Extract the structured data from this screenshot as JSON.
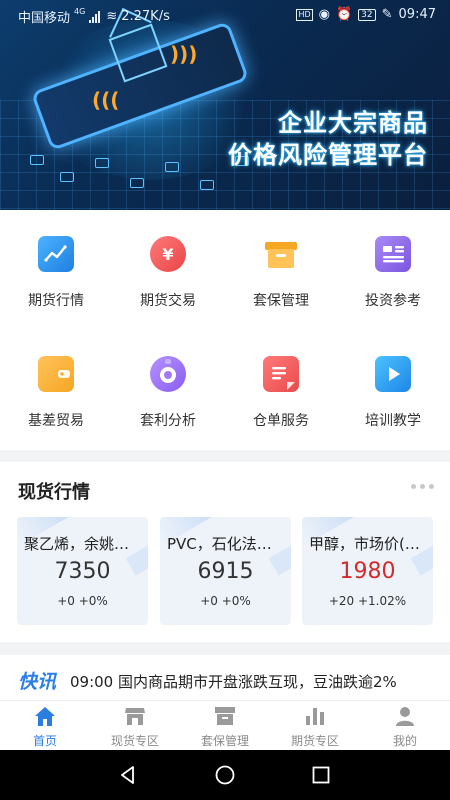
{
  "status_bar": {
    "carrier": "中国移动",
    "network": "4G",
    "speed": "2.27K/s",
    "battery": "32",
    "time": "09:47"
  },
  "banner": {
    "title_line1": "企业大宗商品",
    "title_line2": "价格风险管理平台"
  },
  "functions": [
    {
      "label": "期货行情",
      "icon": "line-chart-icon",
      "color": "#2a8fe8"
    },
    {
      "label": "期货交易",
      "icon": "yen-coin-icon",
      "color": "#ef5a5a"
    },
    {
      "label": "套保管理",
      "icon": "archive-box-icon",
      "color": "#f5a623"
    },
    {
      "label": "投资参考",
      "icon": "document-card-icon",
      "color": "#8b63e6"
    },
    {
      "label": "基差贸易",
      "icon": "wallet-icon",
      "color": "#f5a623"
    },
    {
      "label": "套利分析",
      "icon": "camera-lens-icon",
      "color": "#9a6ef0"
    },
    {
      "label": "仓单服务",
      "icon": "receipt-icon",
      "color": "#ef5a5a"
    },
    {
      "label": "培训教学",
      "icon": "play-video-icon",
      "color": "#2a8fe8"
    }
  ],
  "spot_market": {
    "title": "现货行情",
    "items": [
      {
        "name": "聚乙烯，余姚…",
        "price": "7350",
        "change": "+0 +0%",
        "up": false
      },
      {
        "name": "PVC，石化法…",
        "price": "6915",
        "change": "+0 +0%",
        "up": false
      },
      {
        "name": "甲醇，市场价(…",
        "price": "1980",
        "change": "+20 +1.02%",
        "up": true
      }
    ]
  },
  "news": {
    "tag": "快讯",
    "text": "09:00 国内商品期市开盘涨跌互现，豆油跌逾2%"
  },
  "tabs": [
    {
      "label": "首页",
      "icon": "home-icon",
      "active": true
    },
    {
      "label": "现货专区",
      "icon": "store-icon",
      "active": false
    },
    {
      "label": "套保管理",
      "icon": "archive-box-icon",
      "active": false
    },
    {
      "label": "期货专区",
      "icon": "bar-chart-icon",
      "active": false
    },
    {
      "label": "我的",
      "icon": "user-icon",
      "active": false
    }
  ],
  "colors": {
    "accent": "#2a7de1",
    "price_up": "#d12a2a"
  }
}
